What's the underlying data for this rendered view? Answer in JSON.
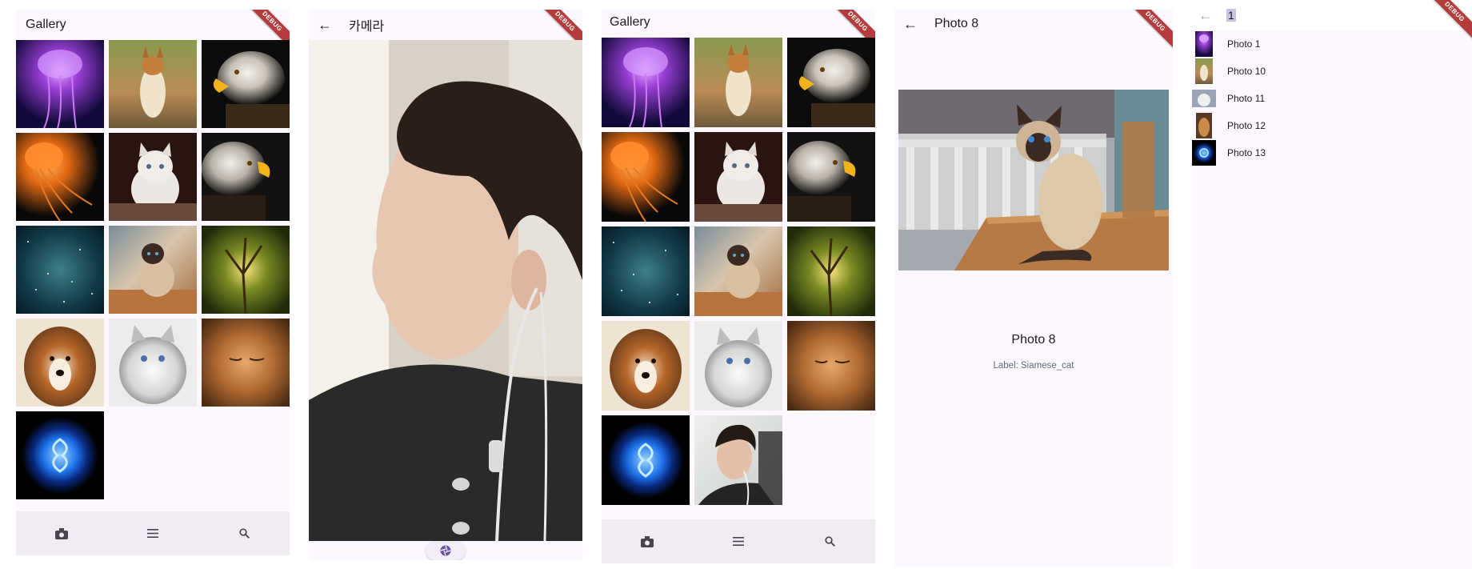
{
  "gallery_screen": {
    "title": "Gallery",
    "debug_label": "DEBUG",
    "photos": [
      {
        "name": "jellyfish-purple"
      },
      {
        "name": "dog-corgi-standing"
      },
      {
        "name": "eagle-head"
      },
      {
        "name": "jellyfish-orange"
      },
      {
        "name": "kitten-white"
      },
      {
        "name": "eagle-side"
      },
      {
        "name": "milky-way"
      },
      {
        "name": "siamese-cat"
      },
      {
        "name": "tree-canopy"
      },
      {
        "name": "sheltie-dog"
      },
      {
        "name": "ragdoll-cat"
      },
      {
        "name": "orange-cat"
      },
      {
        "name": "blue-jellyfish"
      }
    ],
    "nav": {
      "camera": "camera-icon",
      "menu": "menu-icon",
      "search": "search-icon"
    }
  },
  "camera_screen": {
    "title": "카메라",
    "debug_label": "DEBUG",
    "shutter": "shutter-icon"
  },
  "gallery_screen_2": {
    "title": "Gallery",
    "debug_label": "DEBUG"
  },
  "detail_screen": {
    "title": "Photo 8",
    "debug_label": "DEBUG",
    "caption_title": "Photo 8",
    "caption_label": "Label: Siamese_cat"
  },
  "list_screen": {
    "search_value": "1",
    "debug_label": "DEBUG",
    "items": [
      {
        "label": "Photo 1"
      },
      {
        "label": "Photo 10"
      },
      {
        "label": "Photo 11"
      },
      {
        "label": "Photo 12"
      },
      {
        "label": "Photo 13"
      }
    ]
  },
  "colors": {
    "surface": "#fdf7ff",
    "nav_bar": "#f1ebf4",
    "debug_banner": "#b43c3c",
    "accent_purple": "#6750a4"
  }
}
